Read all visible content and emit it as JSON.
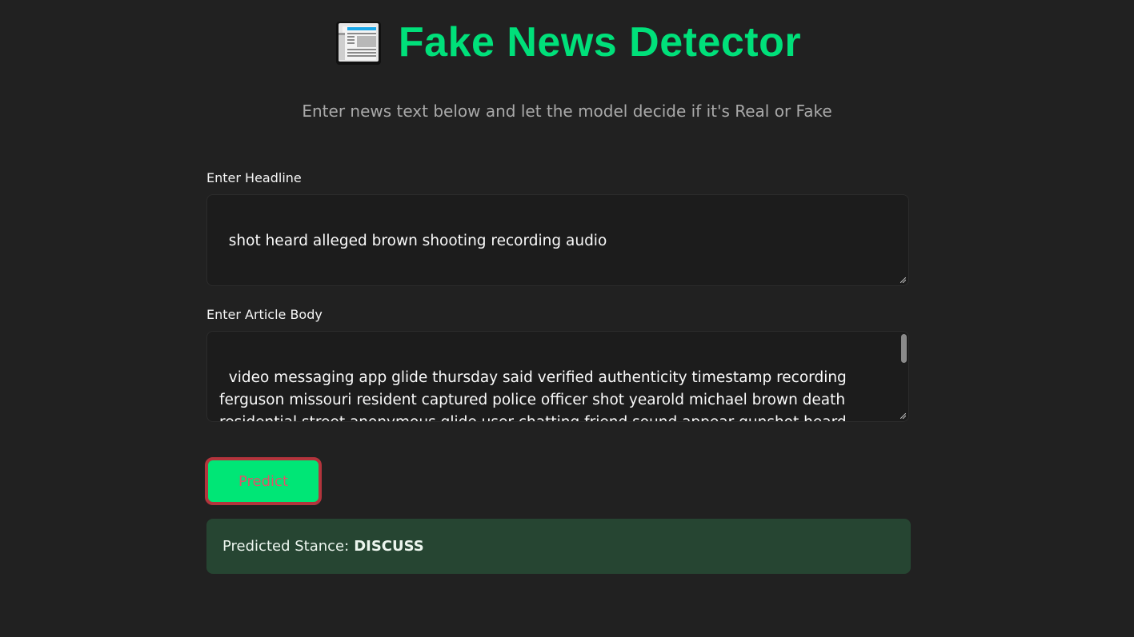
{
  "header": {
    "icon": "newspaper-icon",
    "title": "Fake News Detector",
    "subtitle": "Enter news text below and let the model decide if it's Real or Fake"
  },
  "form": {
    "headline_label": "Enter Headline",
    "headline_value": "shot heard alleged brown shooting recording audio",
    "body_label": "Enter Article Body",
    "body_value": "video messaging app glide thursday said verified authenticity timestamp recording ferguson missouri resident captured police officer shot yearold michael brown death residential street anonymous glide user chatting friend sound appear gunshot heard background cnn video user turned video fbi evidence forensic audio expert paul ginsberg told cnn detected six shot followed four",
    "predict_label": "Predict"
  },
  "result": {
    "label": "Predicted Stance:",
    "value": "DISCUSS"
  },
  "colors": {
    "accent": "#00e07a",
    "background": "#212121",
    "button_fill": "#00e676",
    "button_border": "#b3343c",
    "result_background": "#264532"
  }
}
